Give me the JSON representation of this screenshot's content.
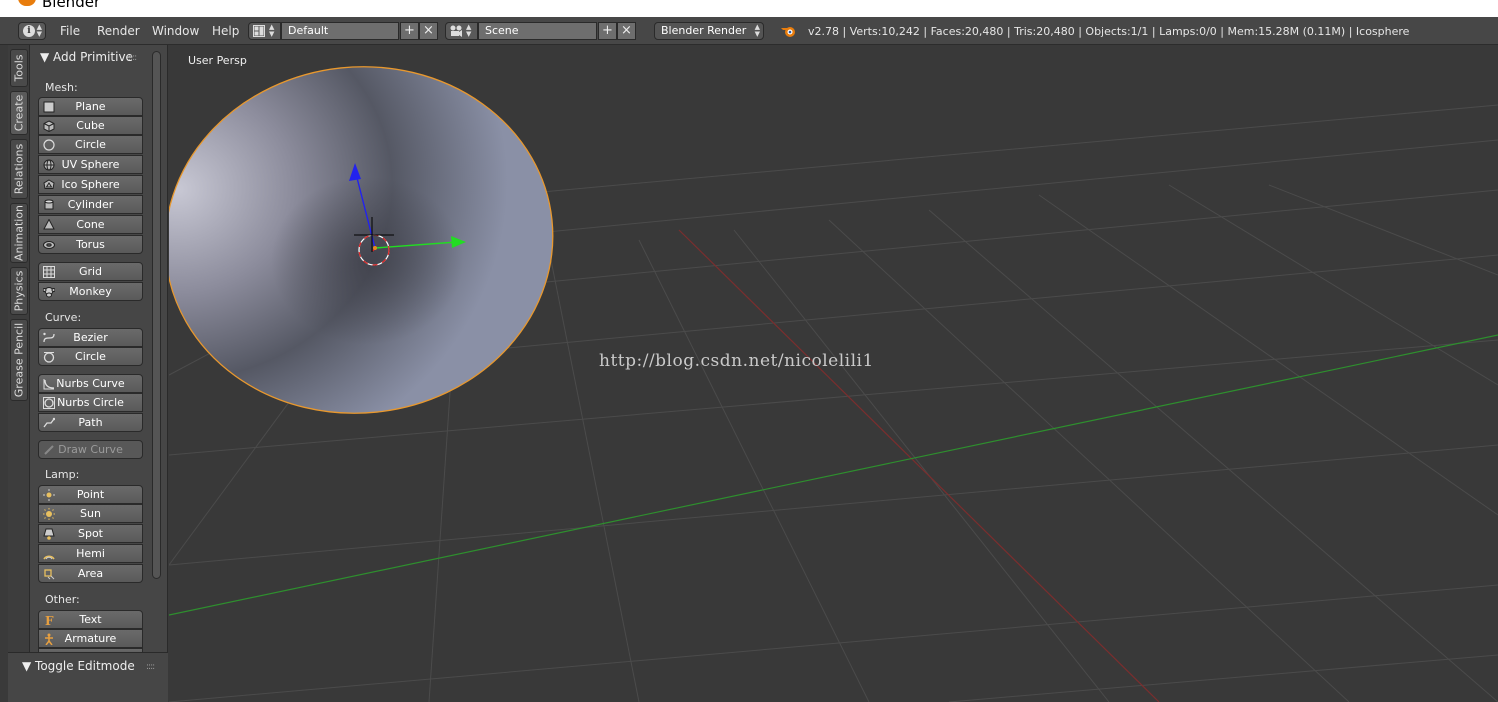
{
  "window": {
    "title": "Blender"
  },
  "topbar": {
    "menus": [
      "File",
      "Render",
      "Window",
      "Help"
    ],
    "layout": "Default",
    "scene": "Scene",
    "render_engine": "Blender Render",
    "stats": "v2.78 | Verts:10,242 | Faces:20,480 | Tris:20,480 | Objects:1/1 | Lamps:0/0 | Mem:15.28M (0.11M) | Icosphere"
  },
  "sidetabs": [
    "Tools",
    "Create",
    "Relations",
    "Animation",
    "Physics",
    "Grease Pencil"
  ],
  "toolpanel": {
    "header": "Add Primitive",
    "mesh_label": "Mesh:",
    "mesh": [
      "Plane",
      "Cube",
      "Circle",
      "UV Sphere",
      "Ico Sphere",
      "Cylinder",
      "Cone",
      "Torus"
    ],
    "mesh2": [
      "Grid",
      "Monkey"
    ],
    "curve_label": "Curve:",
    "curve": [
      "Bezier",
      "Circle"
    ],
    "curve2": [
      "Nurbs Curve",
      "Nurbs Circle",
      "Path"
    ],
    "draw_curve": "Draw Curve",
    "lamp_label": "Lamp:",
    "lamp": [
      "Point",
      "Sun",
      "Spot",
      "Hemi",
      "Area"
    ],
    "other_label": "Other:",
    "other": [
      "Text",
      "Armature"
    ],
    "toggle_editmode": "Toggle Editmode"
  },
  "viewport": {
    "view_label": "User Persp",
    "watermark": "http://blog.csdn.net/nicolelili1"
  },
  "colors": {
    "selection_outline": "#e8982e",
    "x_axis": "#8b2f2f",
    "y_axis": "#2fa12f",
    "accent": "#e87d0d"
  }
}
